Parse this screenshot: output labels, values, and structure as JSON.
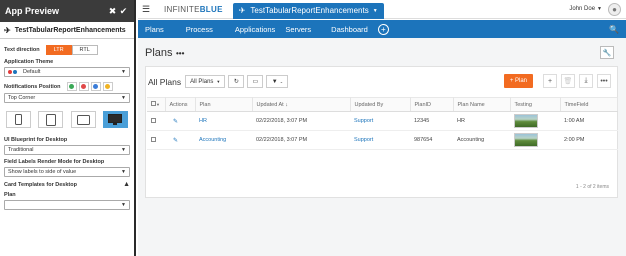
{
  "preview": {
    "title": "App Preview",
    "app_name": "TestTabularReportEnhancements",
    "text_direction": {
      "label": "Text direction",
      "options": [
        "LTR",
        "RTL"
      ],
      "selected": "LTR"
    },
    "theme": {
      "label": "Application Theme",
      "value": "Default"
    },
    "notifications": {
      "label": "Notifications Position",
      "value": "Top Corner"
    },
    "blueprint": {
      "label": "UI Blueprint for Desktop",
      "value": "Traditional"
    },
    "field_labels": {
      "label": "Field Labels Render Mode for Desktop",
      "value": "Show labels to side of value"
    },
    "card_templates": {
      "label": "Card Templates for Desktop",
      "sub_label": "Plan",
      "value": ""
    }
  },
  "topbar": {
    "brand_a": "INFINITE",
    "brand_b": "BLUE",
    "app_tab": "TestTabularReportEnhancements",
    "user": "John Doe"
  },
  "nav": {
    "items": [
      "Plans",
      "Process",
      "Applications",
      "Servers",
      "Dashboard"
    ]
  },
  "page": {
    "title": "Plans",
    "more": "•••",
    "list_title": "All Plans",
    "filter": "All Plans",
    "add_button": "+ Plan",
    "columns": [
      "Actions",
      "Plan",
      "Updated At",
      "Updated By",
      "PlanID",
      "Plan Name",
      "Testing",
      "TimeField"
    ],
    "rows": [
      {
        "plan": "HR",
        "updated_at": "02/22/2018, 3:07 PM",
        "updated_by": "Support",
        "plan_id": "12345",
        "plan_name": "HR",
        "time": "1:00 AM"
      },
      {
        "plan": "Accounting",
        "updated_at": "02/22/2018, 3:07 PM",
        "updated_by": "Support",
        "plan_id": "987654",
        "plan_name": "Accounting",
        "time": "2:00 PM"
      }
    ],
    "pager": "1 - 2 of 2 items"
  },
  "colors": {
    "accent": "#f26b21",
    "brand": "#1c74bb",
    "panel_header": "#3b3b3b"
  }
}
